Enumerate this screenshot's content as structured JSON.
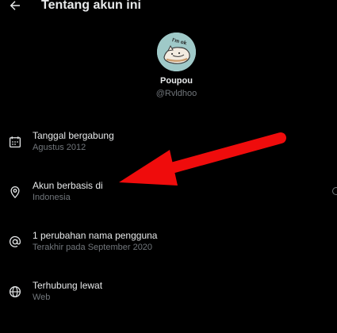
{
  "header": {
    "title": "Tentang akun ini"
  },
  "profile": {
    "display_name": "Poupou",
    "handle": "@Rvldhoo",
    "avatar_text": "I'm ok"
  },
  "rows": [
    {
      "label": "Tanggal bergabung",
      "value": "Agustus 2012",
      "icon": "calendar-icon"
    },
    {
      "label": "Akun berbasis di",
      "value": "Indonesia",
      "icon": "location-pin-icon"
    },
    {
      "label": "1 perubahan nama pengguna",
      "value": "Terakhir pada September 2020",
      "icon": "at-sign-icon"
    },
    {
      "label": "Terhubung lewat",
      "value": "Web",
      "icon": "globe-icon"
    }
  ],
  "colors": {
    "background": "#000000",
    "primary_text": "#e7e9ea",
    "secondary_text": "#71767b",
    "arrow": "#ef0c0c",
    "avatar_bg": "#9fc9c8"
  }
}
